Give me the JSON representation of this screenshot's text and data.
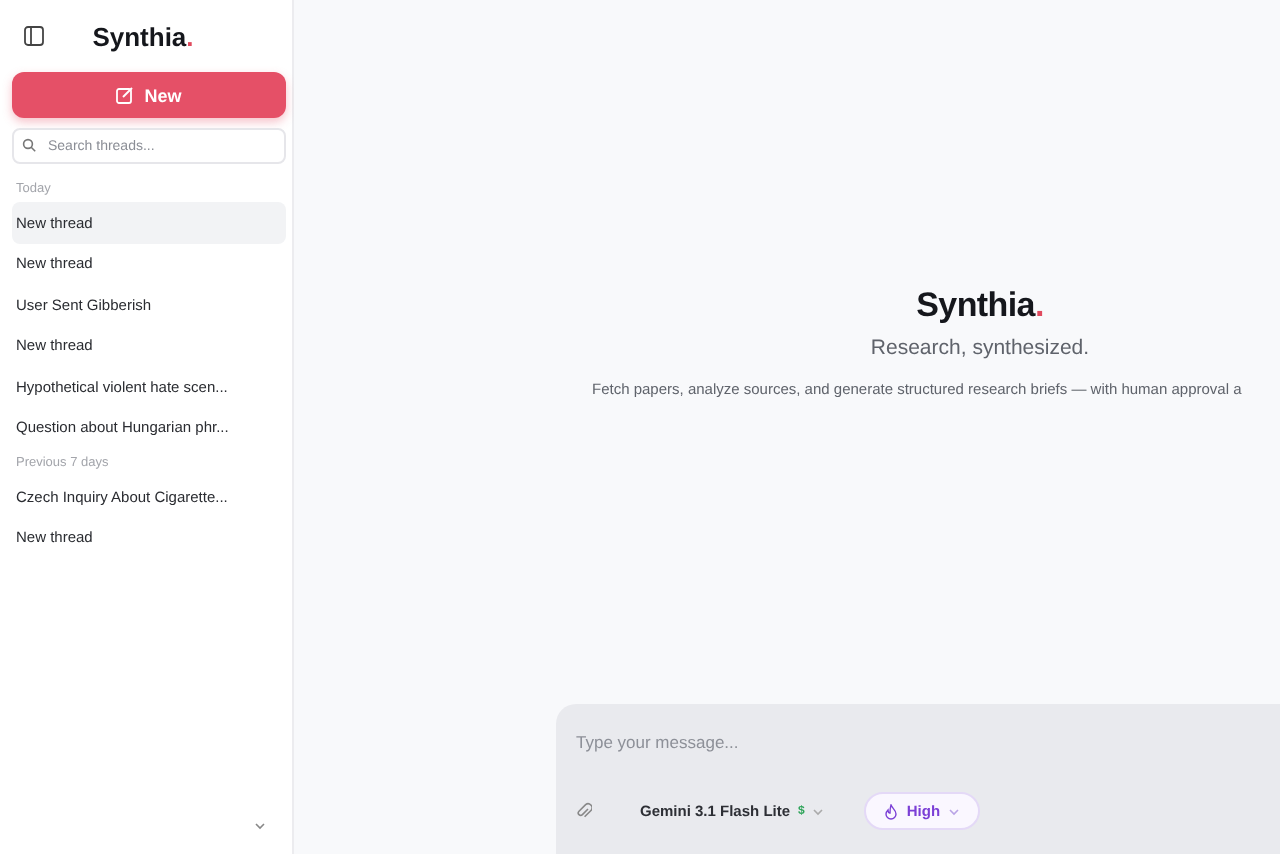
{
  "sidebar": {
    "brand": "Synthia",
    "brand_dot": ".",
    "new_button": "New",
    "search": {
      "placeholder": "Search threads..."
    },
    "groups": [
      {
        "label": "Today",
        "items": [
          {
            "title": "New thread",
            "selected": true
          },
          {
            "title": "New thread",
            "selected": false
          },
          {
            "title": "User Sent Gibberish",
            "selected": false
          },
          {
            "title": "New thread",
            "selected": false
          },
          {
            "title": "Hypothetical violent hate scen...",
            "selected": false
          },
          {
            "title": "Question about Hungarian phr...",
            "selected": false
          }
        ]
      },
      {
        "label": "Previous 7 days",
        "items": [
          {
            "title": "Czech Inquiry About Cigarette...",
            "selected": false
          },
          {
            "title": "New thread",
            "selected": false
          }
        ]
      }
    ]
  },
  "hero": {
    "title": "Synthia",
    "title_dot": ".",
    "tagline": "Research, synthesized.",
    "description": "Fetch papers, analyze sources, and generate structured research briefs — with human approval a"
  },
  "composer": {
    "placeholder": "Type your message...",
    "model": "Gemini 3.1 Flash Lite",
    "price": "$",
    "effort": "High"
  }
}
